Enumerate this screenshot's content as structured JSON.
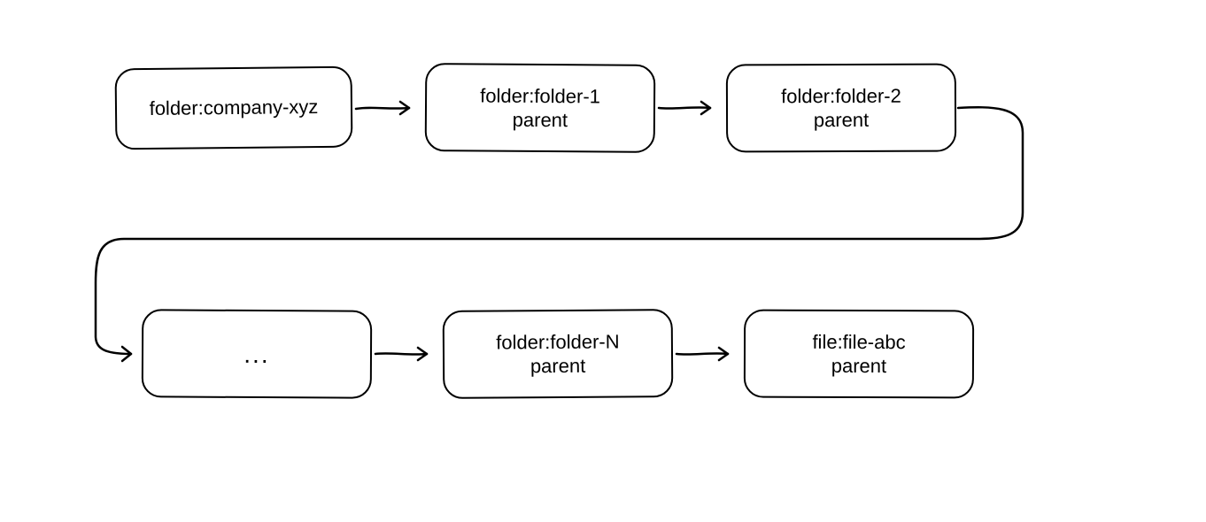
{
  "nodes": {
    "n1": {
      "line1": "folder:company-xyz",
      "line2": ""
    },
    "n2": {
      "line1": "folder:folder-1",
      "line2": "parent"
    },
    "n3": {
      "line1": "folder:folder-2",
      "line2": "parent"
    },
    "n4": {
      "line1": "...",
      "line2": ""
    },
    "n5": {
      "line1": "folder:folder-N",
      "line2": "parent"
    },
    "n6": {
      "line1": "file:file-abc",
      "line2": "parent"
    }
  }
}
